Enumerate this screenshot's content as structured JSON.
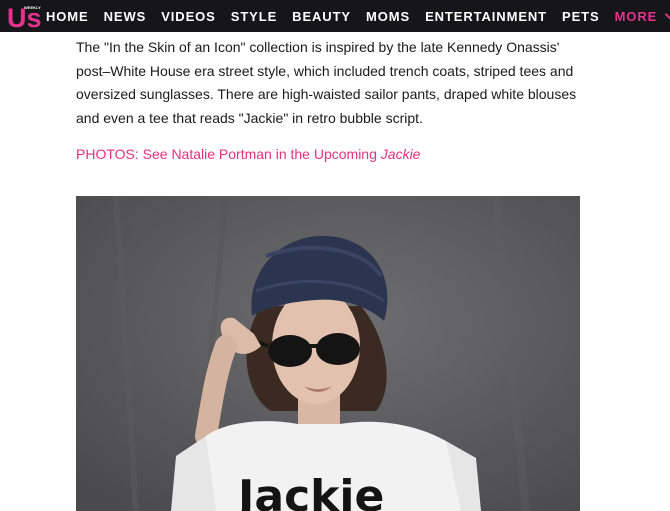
{
  "header": {
    "logo_text": "Us",
    "logo_small_text": "WEEKLY",
    "nav_items": [
      "HOME",
      "NEWS",
      "VIDEOS",
      "STYLE",
      "BEAUTY",
      "MOMS",
      "ENTERTAINMENT",
      "PETS"
    ],
    "more_label": "MORE",
    "more_icon": "chevron-down-icon",
    "accent_color": "#e8308e",
    "bg_color": "#16161a"
  },
  "article": {
    "paragraph": "The \"In the Skin of an Icon\" collection is inspired by the late Kennedy Onassis' post–White House era street style, which included trench coats, striped tees and oversized sunglasses. There are high-waisted sailor pants, draped white blouses and even a tee that reads \"Jackie\" in retro bubble script.",
    "photo_link_prefix": "PHOTOS: See Natalie Portman in the Upcoming ",
    "photo_link_italic": "Jackie",
    "link_color": "#e8307f"
  },
  "photo": {
    "tee_text": "Jackie"
  }
}
